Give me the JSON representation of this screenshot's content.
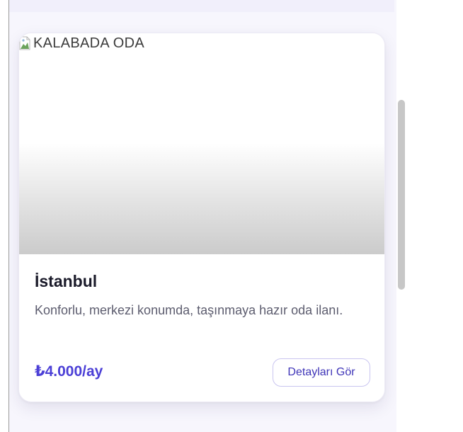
{
  "listing": {
    "image_alt": "KALABADA ODA",
    "city": "İstanbul",
    "description": "Konforlu, merkezi konumda, taşınmaya hazır oda ilanı.",
    "price": "₺4.000/ay",
    "details_button_label": "Detayları Gör"
  },
  "icons": {
    "broken_image": "broken-image-icon"
  },
  "colors": {
    "accent": "#4b3fd6",
    "button_border": "#c9c5f0",
    "page_background": "#f7f6fd",
    "title_text": "#1b1b2a",
    "body_text": "#5c5c6e"
  }
}
